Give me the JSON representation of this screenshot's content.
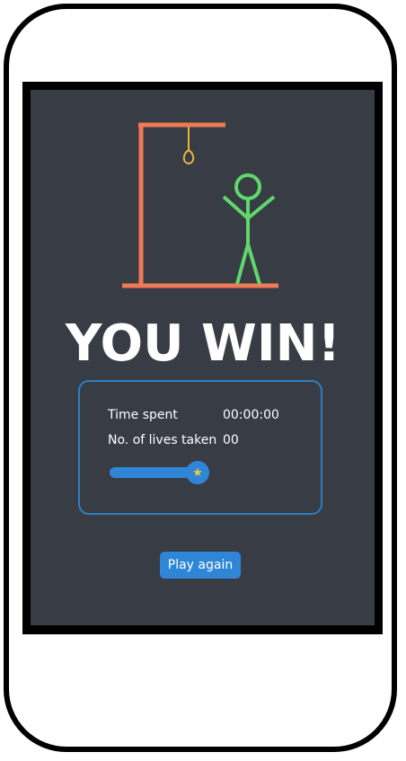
{
  "result": {
    "title": "YOU WIN!"
  },
  "stats": {
    "time_label": "Time spent",
    "time_value": "00:00:00",
    "lives_label": "No. of lives taken",
    "lives_value": "00",
    "progress_fraction": 1.0
  },
  "actions": {
    "play_again_label": "Play again"
  },
  "colors": {
    "screen_bg": "#383c45",
    "gallows": "#f07a55",
    "noose": "#e8b43a",
    "stickman": "#5fd86b",
    "accent": "#2f86d6",
    "box_border": "#2f7fc1",
    "star": "#f3c93a"
  },
  "icons": {
    "progress_knob": "star-icon"
  }
}
